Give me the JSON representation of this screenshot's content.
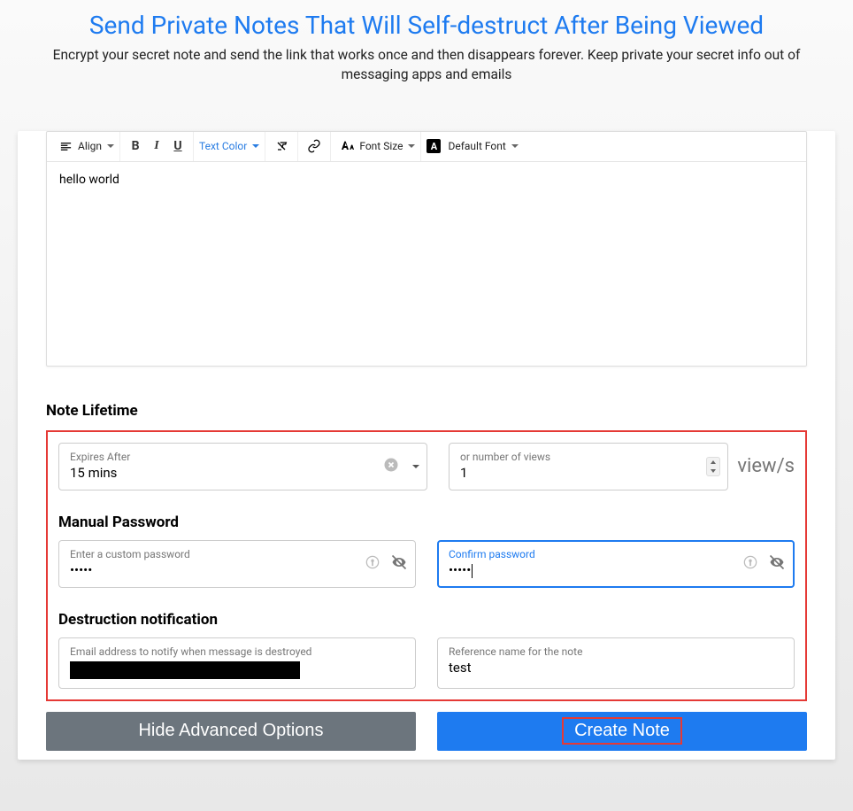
{
  "header": {
    "title": "Send Private Notes That Will Self-destruct After Being Viewed",
    "subtitle": "Encrypt your secret note and send the link that works once and then disappears forever. Keep private your secret info out of messaging apps and emails"
  },
  "toolbar": {
    "align_label": "Align",
    "text_color_label": "Text Color",
    "font_size_label": "Font Size",
    "default_font_label": "Default Font"
  },
  "editor": {
    "content": "hello world"
  },
  "sections": {
    "note_lifetime": "Note Lifetime",
    "manual_password": "Manual Password",
    "destruction_notification": "Destruction notification"
  },
  "fields": {
    "expires_label": "Expires After",
    "expires_value": "15 mins",
    "views_label": "or number of views",
    "views_value": "1",
    "views_suffix": "view/s",
    "password_label": "Enter a custom password",
    "password_value": "•••••",
    "confirm_label": "Confirm password",
    "confirm_value": "•••••",
    "email_label": "Email address to notify when message is destroyed",
    "reference_label": "Reference name for the note",
    "reference_value": "test"
  },
  "buttons": {
    "hide_advanced": "Hide Advanced Options",
    "create_note": "Create Note"
  }
}
